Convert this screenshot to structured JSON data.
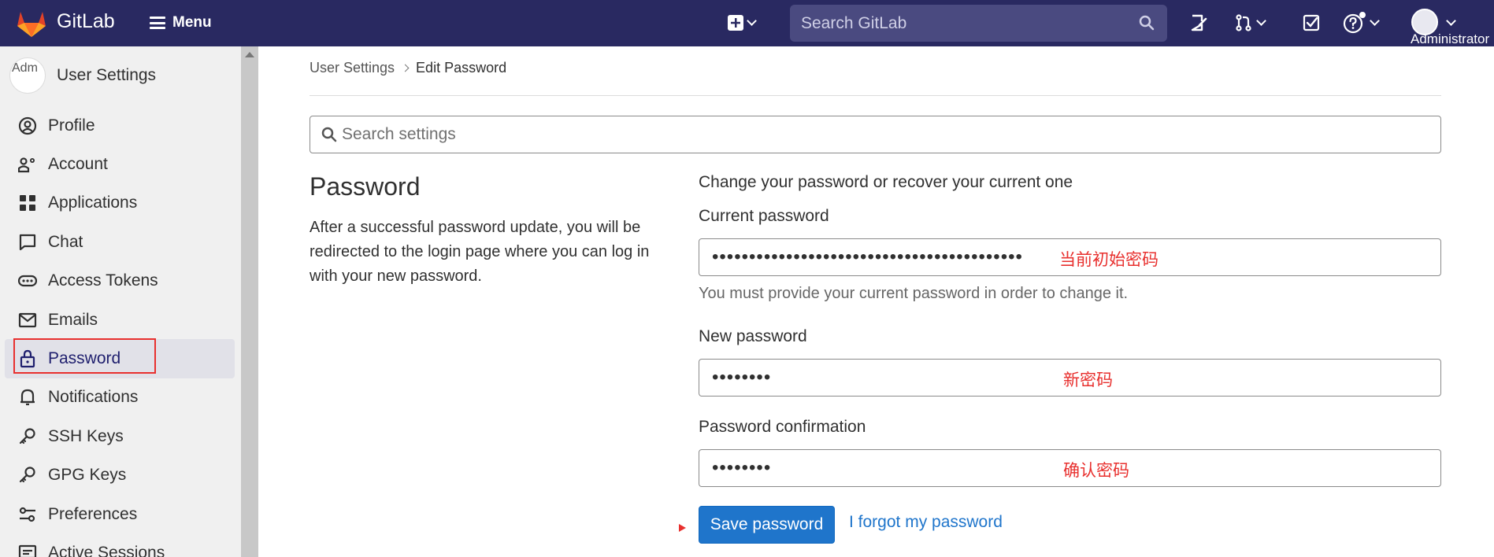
{
  "topbar": {
    "brand": "GitLab",
    "menu_label": "Menu",
    "search_placeholder": "Search GitLab",
    "user_label": "Administrator",
    "bg_color": "#292961"
  },
  "sidebar": {
    "title": "User Settings",
    "avatar_alt": "Adm",
    "items": [
      {
        "label": "Profile",
        "icon": "profile-icon"
      },
      {
        "label": "Account",
        "icon": "account-icon"
      },
      {
        "label": "Applications",
        "icon": "applications-icon"
      },
      {
        "label": "Chat",
        "icon": "chat-icon"
      },
      {
        "label": "Access Tokens",
        "icon": "token-icon"
      },
      {
        "label": "Emails",
        "icon": "mail-icon"
      },
      {
        "label": "Password",
        "icon": "lock-icon",
        "active": true
      },
      {
        "label": "Notifications",
        "icon": "bell-icon"
      },
      {
        "label": "SSH Keys",
        "icon": "key-icon"
      },
      {
        "label": "GPG Keys",
        "icon": "key-icon"
      },
      {
        "label": "Preferences",
        "icon": "preferences-icon"
      },
      {
        "label": "Active Sessions",
        "icon": "sessions-icon"
      }
    ]
  },
  "breadcrumb": {
    "parent": "User Settings",
    "current": "Edit Password"
  },
  "settings_search": {
    "placeholder": "Search settings"
  },
  "section": {
    "title": "Password",
    "description": "After a successful password update, you will be redirected to the login page where you can log in with your new password."
  },
  "form": {
    "heading": "Change your password or recover your current one",
    "current_password": {
      "label": "Current password",
      "value": "••••••••••••••••••••••••••••••••••••••••••",
      "annotation": "当前初始密码",
      "help": "You must provide your current password in order to change it."
    },
    "new_password": {
      "label": "New password",
      "value": "••••••••",
      "annotation": "新密码"
    },
    "password_confirmation": {
      "label": "Password confirmation",
      "value": "••••••••",
      "annotation": "确认密码"
    },
    "save_label": "Save password",
    "forgot_label": "I forgot my password"
  },
  "colors": {
    "accent": "#1f75cb",
    "annotation_red": "#e8302e"
  }
}
